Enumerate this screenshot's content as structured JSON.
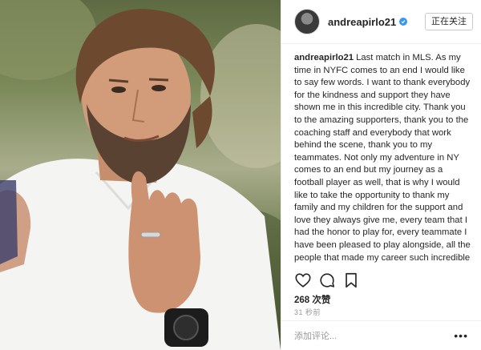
{
  "photo": {
    "icon": "portrait-photo",
    "subject": ""
  },
  "header": {
    "username": "andreapirlo21",
    "verified_icon": "verified-badge-icon",
    "follow_label": "正在关注"
  },
  "caption": {
    "username": "andreapirlo21",
    "text": "Last match in MLS. As my time in NYFC comes to an end I would like to say few words. I want to thank everybody for the kindness and support they have shown me in this incredible city. Thank you to the amazing supporters, thank you to the coaching staff and everybody that work behind the scene, thank you to my teammates. Not only my adventure in NY comes to an end but my journey as a football player as well, that is why I would like to take the opportunity to thank my family and my children for the support and love they always give me, every team that I had the honor to play for, every teammate I have been pleased to play alongside, all the people that made my career such incredible and last but not least, all the fans around the world that always showed me support. You will"
  },
  "actions": {
    "like_icon": "heart-icon",
    "comment_icon": "comment-icon",
    "save_icon": "bookmark-icon"
  },
  "likes": "268 次赞",
  "time": "31 秒前",
  "comment": {
    "placeholder": "添加评论...",
    "more_label": "•••"
  },
  "colors": {
    "verified": "#3897f0",
    "text": "#262626",
    "muted": "#999999",
    "border": "#efefef"
  }
}
